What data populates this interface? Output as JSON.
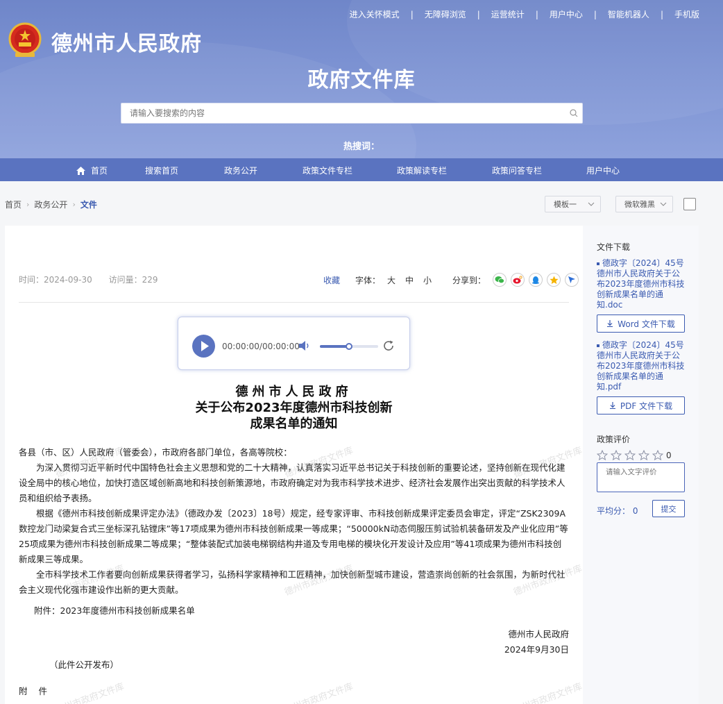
{
  "header": {
    "top_links": [
      "进入关怀模式",
      "无障碍浏览",
      "运营统计",
      "用户中心",
      "智能机器人",
      "手机版"
    ],
    "site_title": "德州市人民政府",
    "library_title": "政府文件库",
    "search_placeholder": "请输入要搜索的内容",
    "hot_search_label": "热搜词："
  },
  "nav": {
    "items": [
      "首页",
      "搜索首页",
      "政务公开",
      "政策文件专栏",
      "政策解读专栏",
      "政策问答专栏",
      "用户中心"
    ]
  },
  "breadcrumb": [
    "首页",
    "政务公开",
    "文件"
  ],
  "selects": {
    "template": "模板一",
    "font": "微软雅黑"
  },
  "article": {
    "time": "时间：2024-09-30",
    "visits": "访问量：229",
    "favorite": "收藏",
    "font_label": "字体：",
    "font_sizes": [
      "大",
      "中",
      "小"
    ],
    "share_label": "分享到：",
    "player": {
      "time": "00:00:00/00:00:00",
      "volume": 0.5
    },
    "title_line1": "德州市人民政府",
    "title_line2": "关于公布2023年度德州市科技创新",
    "title_line3": "成果名单的通知",
    "salutation": "各县（市、区）人民政府（管委会），市政府各部门单位，各高等院校：",
    "para1": "为深入贯彻习近平新时代中国特色社会主义思想和党的二十大精神，认真落实习近平总书记关于科技创新的重要论述，坚持创新在现代化建设全局中的核心地位，加快打造区域创新高地和科技创新策源地，市政府确定对为我市科学技术进步、经济社会发展作出突出贡献的科学技术人员和组织给予表扬。",
    "para2": "根据《德州市科技创新成果评定办法》（德政办发〔2023〕18号）规定，经专家评审、市科技创新成果评定委员会审定，评定“ZSK2309A数控龙门动梁复合式三坐标深孔钻镗床”等17项成果为德州市科技创新成果一等成果；“50000kN动态伺服压剪试验机装备研发及产业化应用”等25项成果为德州市科技创新成果二等成果；“整体装配式加装电梯钢结构井道及专用电梯的模块化开发设计及应用”等41项成果为德州市科技创新成果三等成果。",
    "para3": "全市科学技术工作者要向创新成果获得者学习，弘扬科学家精神和工匠精神，加快创新型城市建设，营造崇尚创新的社会氛围，为新时代社会主义现代化强市建设作出新的更大贡献。",
    "attachment_line": "附件：2023年度德州市科技创新成果名单",
    "signer": "德州市人民政府",
    "date": "2024年9月30日",
    "publish_note": "（此件公开发布）",
    "attachment_heading": "附 件",
    "watermark": "德州市政府文件库"
  },
  "sidebar": {
    "downloads_title": "文件下载",
    "file1": "德政字〔2024〕45号德州市人民政府关于公布2023年度德州市科技创新成果名单的通知.doc",
    "file1_button": "Word 文件下载",
    "file2": "德政字〔2024〕45号德州市人民政府关于公布2023年度德州市科技创新成果名单的通知.pdf",
    "file2_button": "PDF 文件下载",
    "rating_title": "政策评价",
    "rating_count": "0",
    "rating_placeholder": "请输入文字评价",
    "average": "平均分：  0",
    "submit": "提交"
  }
}
